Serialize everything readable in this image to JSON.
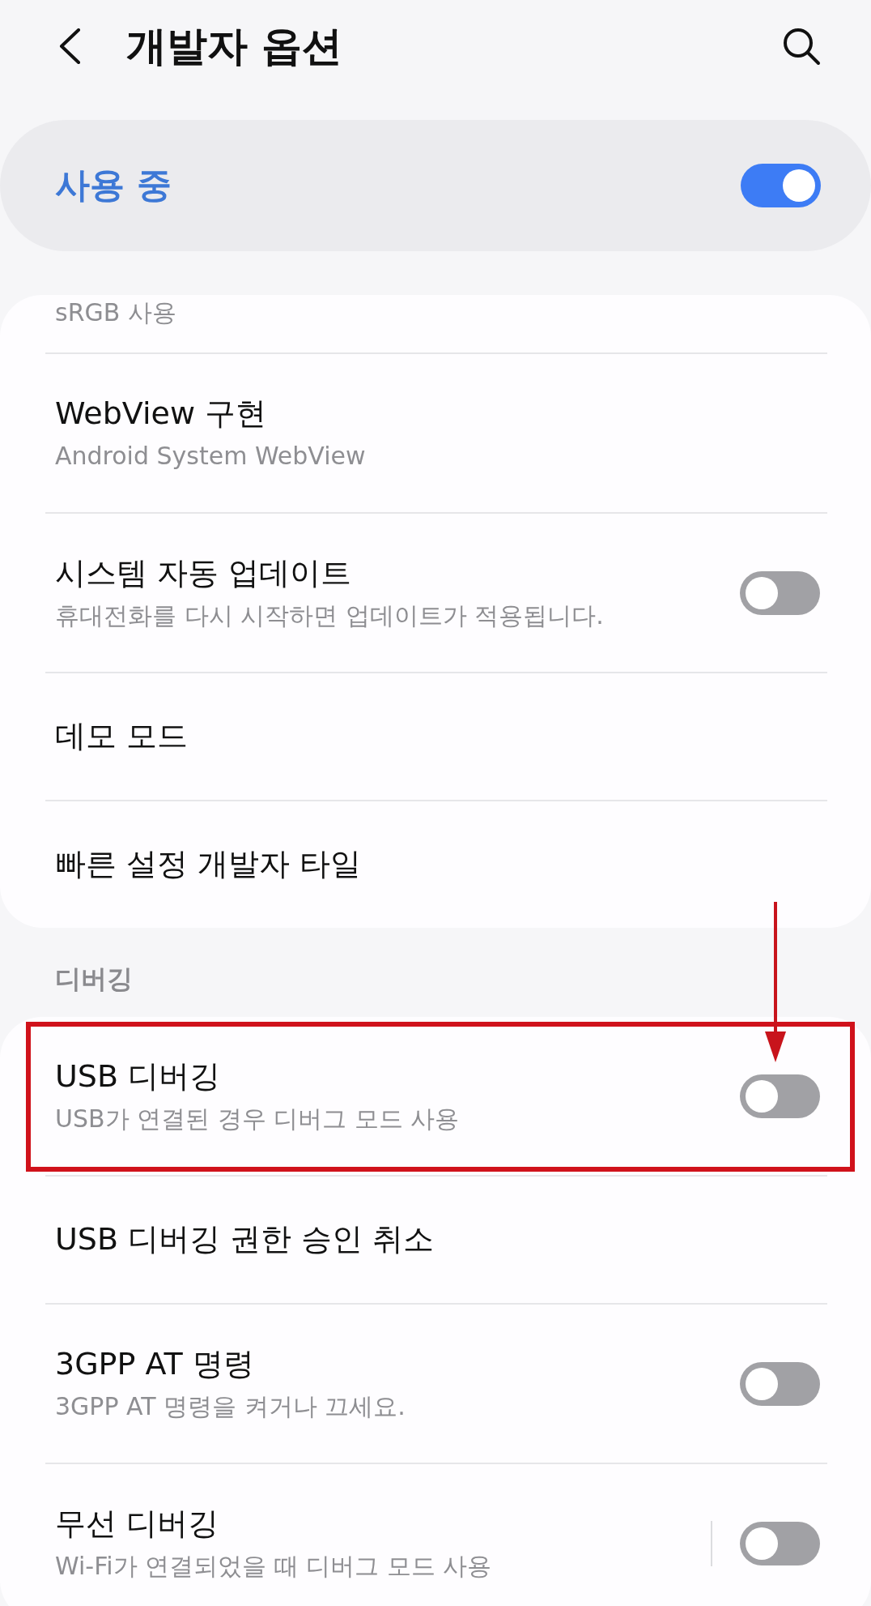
{
  "header": {
    "title": "개발자 옵션"
  },
  "master_switch": {
    "label": "사용 중",
    "on": true
  },
  "groups": [
    {
      "cut_subtitle": "sRGB 사용",
      "items": [
        {
          "kind": "plain",
          "title": "WebView 구현",
          "subtitle": "Android System WebView",
          "highlighted": false
        },
        {
          "kind": "switch",
          "title": "시스템 자동 업데이트",
          "subtitle": "휴대전화를 다시 시작하면 업데이트가 적용됩니다.",
          "on": false,
          "highlighted": false
        },
        {
          "kind": "plain",
          "title": "데모 모드",
          "highlighted": false
        },
        {
          "kind": "plain",
          "title": "빠른 설정 개발자 타일",
          "highlighted": false
        }
      ]
    },
    {
      "heading": "디버깅",
      "items": [
        {
          "kind": "switch",
          "title": "USB 디버깅",
          "subtitle": "USB가 연결된 경우 디버그 모드 사용",
          "on": false,
          "highlighted": true
        },
        {
          "kind": "plain",
          "title": "USB 디버깅 권한 승인 취소",
          "highlighted": false
        },
        {
          "kind": "switch",
          "title": "3GPP AT 명령",
          "subtitle": "3GPP AT 명령을 켜거나 끄세요.",
          "on": false,
          "highlighted": false
        },
        {
          "kind": "split-switch",
          "title": "무선 디버깅",
          "subtitle": "Wi-Fi가 연결되었을 때 디버그 모드 사용",
          "on": false,
          "highlighted": false
        }
      ]
    }
  ]
}
